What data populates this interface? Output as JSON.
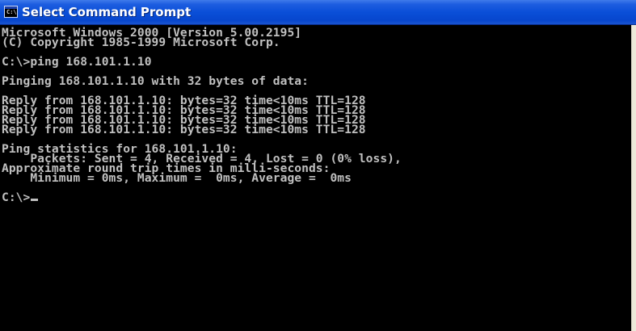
{
  "window": {
    "title": "Select Command Prompt",
    "icon": "command-prompt-icon",
    "icon_glyph": "C:\\"
  },
  "console": {
    "lines": [
      "Microsoft Windows 2000 [Version 5.00.2195]",
      "(C) Copyright 1985-1999 Microsoft Corp.",
      "",
      "C:\\>ping 168.101.1.10",
      "",
      "Pinging 168.101.1.10 with 32 bytes of data:",
      "",
      "Reply from 168.101.1.10: bytes=32 time<10ms TTL=128",
      "Reply from 168.101.1.10: bytes=32 time<10ms TTL=128",
      "Reply from 168.101.1.10: bytes=32 time<10ms TTL=128",
      "Reply from 168.101.1.10: bytes=32 time<10ms TTL=128",
      "",
      "Ping statistics for 168.101.1.10:",
      "    Packets: Sent = 4, Received = 4, Lost = 0 (0% loss),",
      "Approximate round trip times in milli-seconds:",
      "    Minimum = 0ms, Maximum =  0ms, Average =  0ms",
      "",
      "C:\\>"
    ]
  },
  "colors": {
    "titlebar": "#0a4fd8",
    "console_bg": "#000000",
    "console_text": "#c0c0c0"
  }
}
